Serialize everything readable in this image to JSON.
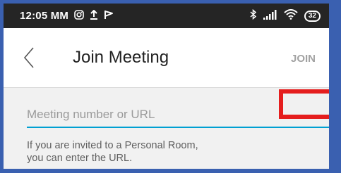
{
  "status_bar": {
    "time": "12:05 MM",
    "icons_left": [
      "instagram-icon",
      "upload-icon",
      "flag-icon"
    ],
    "icons_right": [
      "bluetooth-icon",
      "signal-icon",
      "wifi-icon"
    ],
    "battery": "32"
  },
  "header": {
    "title": "Join Meeting",
    "join_label": "JOIN",
    "join_color": "#a2a2a2"
  },
  "form": {
    "input_placeholder": "Meeting number or URL",
    "input_value": "",
    "underline_color": "#00a0d2",
    "hint_line1": "If you are invited to a Personal Room,",
    "hint_line2": "you can enter the URL."
  },
  "annotation": {
    "highlight_color": "#e51e1e"
  },
  "colors": {
    "frame": "#3a60b0",
    "status_bar": "#252525",
    "background": "#f1f1f1"
  }
}
